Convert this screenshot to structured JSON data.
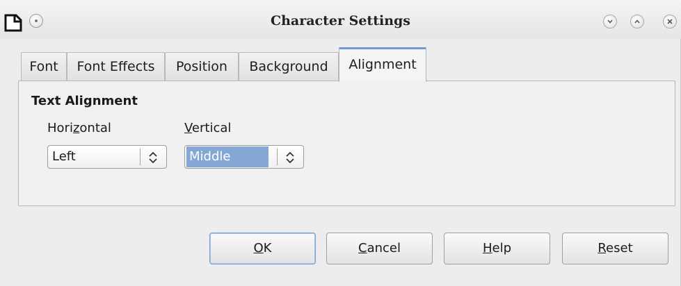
{
  "window": {
    "title": "Character Settings",
    "icons": {
      "app": "document-icon",
      "menu": "window-menu-icon",
      "minimize": "chevron-down-icon",
      "maximize": "chevron-up-icon",
      "close": "close-icon"
    }
  },
  "tabs": [
    {
      "label": "Font"
    },
    {
      "label": "Font Effects"
    },
    {
      "label": "Position"
    },
    {
      "label": "Background"
    },
    {
      "label": "Alignment",
      "active": true
    }
  ],
  "section": {
    "title": "Text Alignment",
    "horizontal": {
      "label_pre": "Hori",
      "label_mn": "z",
      "label_post": "ontal",
      "value": "Left"
    },
    "vertical": {
      "label_pre": "",
      "label_mn": "V",
      "label_post": "ertical",
      "value": "Middle"
    }
  },
  "buttons": {
    "ok": {
      "mn": "O",
      "rest": "K"
    },
    "cancel": {
      "mn": "C",
      "rest": "ancel"
    },
    "help": {
      "mn": "H",
      "rest": "elp"
    },
    "reset": {
      "mn": "R",
      "rest": "eset"
    }
  },
  "colors": {
    "accent": "#6f9ad4",
    "selection": "#84a7d6"
  }
}
